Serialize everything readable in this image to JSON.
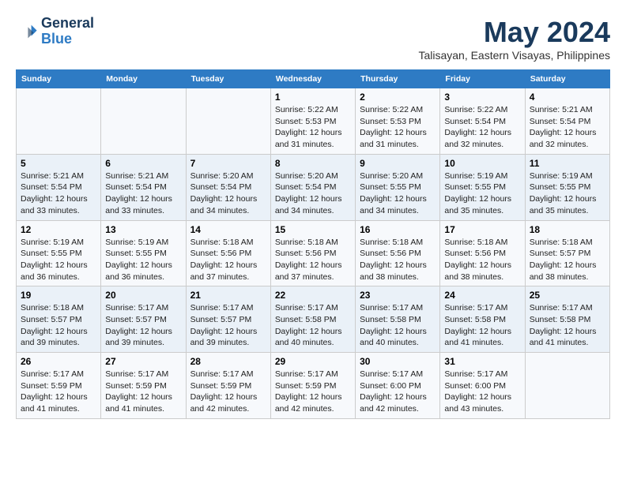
{
  "header": {
    "logo_line1": "General",
    "logo_line2": "Blue",
    "month_title": "May 2024",
    "subtitle": "Talisayan, Eastern Visayas, Philippines"
  },
  "days_of_week": [
    "Sunday",
    "Monday",
    "Tuesday",
    "Wednesday",
    "Thursday",
    "Friday",
    "Saturday"
  ],
  "weeks": [
    {
      "cells": [
        {
          "day": "",
          "content": ""
        },
        {
          "day": "",
          "content": ""
        },
        {
          "day": "",
          "content": ""
        },
        {
          "day": "1",
          "content": "Sunrise: 5:22 AM\nSunset: 5:53 PM\nDaylight: 12 hours\nand 31 minutes."
        },
        {
          "day": "2",
          "content": "Sunrise: 5:22 AM\nSunset: 5:53 PM\nDaylight: 12 hours\nand 31 minutes."
        },
        {
          "day": "3",
          "content": "Sunrise: 5:22 AM\nSunset: 5:54 PM\nDaylight: 12 hours\nand 32 minutes."
        },
        {
          "day": "4",
          "content": "Sunrise: 5:21 AM\nSunset: 5:54 PM\nDaylight: 12 hours\nand 32 minutes."
        }
      ]
    },
    {
      "cells": [
        {
          "day": "5",
          "content": "Sunrise: 5:21 AM\nSunset: 5:54 PM\nDaylight: 12 hours\nand 33 minutes."
        },
        {
          "day": "6",
          "content": "Sunrise: 5:21 AM\nSunset: 5:54 PM\nDaylight: 12 hours\nand 33 minutes."
        },
        {
          "day": "7",
          "content": "Sunrise: 5:20 AM\nSunset: 5:54 PM\nDaylight: 12 hours\nand 34 minutes."
        },
        {
          "day": "8",
          "content": "Sunrise: 5:20 AM\nSunset: 5:54 PM\nDaylight: 12 hours\nand 34 minutes."
        },
        {
          "day": "9",
          "content": "Sunrise: 5:20 AM\nSunset: 5:55 PM\nDaylight: 12 hours\nand 34 minutes."
        },
        {
          "day": "10",
          "content": "Sunrise: 5:19 AM\nSunset: 5:55 PM\nDaylight: 12 hours\nand 35 minutes."
        },
        {
          "day": "11",
          "content": "Sunrise: 5:19 AM\nSunset: 5:55 PM\nDaylight: 12 hours\nand 35 minutes."
        }
      ]
    },
    {
      "cells": [
        {
          "day": "12",
          "content": "Sunrise: 5:19 AM\nSunset: 5:55 PM\nDaylight: 12 hours\nand 36 minutes."
        },
        {
          "day": "13",
          "content": "Sunrise: 5:19 AM\nSunset: 5:55 PM\nDaylight: 12 hours\nand 36 minutes."
        },
        {
          "day": "14",
          "content": "Sunrise: 5:18 AM\nSunset: 5:56 PM\nDaylight: 12 hours\nand 37 minutes."
        },
        {
          "day": "15",
          "content": "Sunrise: 5:18 AM\nSunset: 5:56 PM\nDaylight: 12 hours\nand 37 minutes."
        },
        {
          "day": "16",
          "content": "Sunrise: 5:18 AM\nSunset: 5:56 PM\nDaylight: 12 hours\nand 38 minutes."
        },
        {
          "day": "17",
          "content": "Sunrise: 5:18 AM\nSunset: 5:56 PM\nDaylight: 12 hours\nand 38 minutes."
        },
        {
          "day": "18",
          "content": "Sunrise: 5:18 AM\nSunset: 5:57 PM\nDaylight: 12 hours\nand 38 minutes."
        }
      ]
    },
    {
      "cells": [
        {
          "day": "19",
          "content": "Sunrise: 5:18 AM\nSunset: 5:57 PM\nDaylight: 12 hours\nand 39 minutes."
        },
        {
          "day": "20",
          "content": "Sunrise: 5:17 AM\nSunset: 5:57 PM\nDaylight: 12 hours\nand 39 minutes."
        },
        {
          "day": "21",
          "content": "Sunrise: 5:17 AM\nSunset: 5:57 PM\nDaylight: 12 hours\nand 39 minutes."
        },
        {
          "day": "22",
          "content": "Sunrise: 5:17 AM\nSunset: 5:58 PM\nDaylight: 12 hours\nand 40 minutes."
        },
        {
          "day": "23",
          "content": "Sunrise: 5:17 AM\nSunset: 5:58 PM\nDaylight: 12 hours\nand 40 minutes."
        },
        {
          "day": "24",
          "content": "Sunrise: 5:17 AM\nSunset: 5:58 PM\nDaylight: 12 hours\nand 41 minutes."
        },
        {
          "day": "25",
          "content": "Sunrise: 5:17 AM\nSunset: 5:58 PM\nDaylight: 12 hours\nand 41 minutes."
        }
      ]
    },
    {
      "cells": [
        {
          "day": "26",
          "content": "Sunrise: 5:17 AM\nSunset: 5:59 PM\nDaylight: 12 hours\nand 41 minutes."
        },
        {
          "day": "27",
          "content": "Sunrise: 5:17 AM\nSunset: 5:59 PM\nDaylight: 12 hours\nand 41 minutes."
        },
        {
          "day": "28",
          "content": "Sunrise: 5:17 AM\nSunset: 5:59 PM\nDaylight: 12 hours\nand 42 minutes."
        },
        {
          "day": "29",
          "content": "Sunrise: 5:17 AM\nSunset: 5:59 PM\nDaylight: 12 hours\nand 42 minutes."
        },
        {
          "day": "30",
          "content": "Sunrise: 5:17 AM\nSunset: 6:00 PM\nDaylight: 12 hours\nand 42 minutes."
        },
        {
          "day": "31",
          "content": "Sunrise: 5:17 AM\nSunset: 6:00 PM\nDaylight: 12 hours\nand 43 minutes."
        },
        {
          "day": "",
          "content": ""
        }
      ]
    }
  ]
}
